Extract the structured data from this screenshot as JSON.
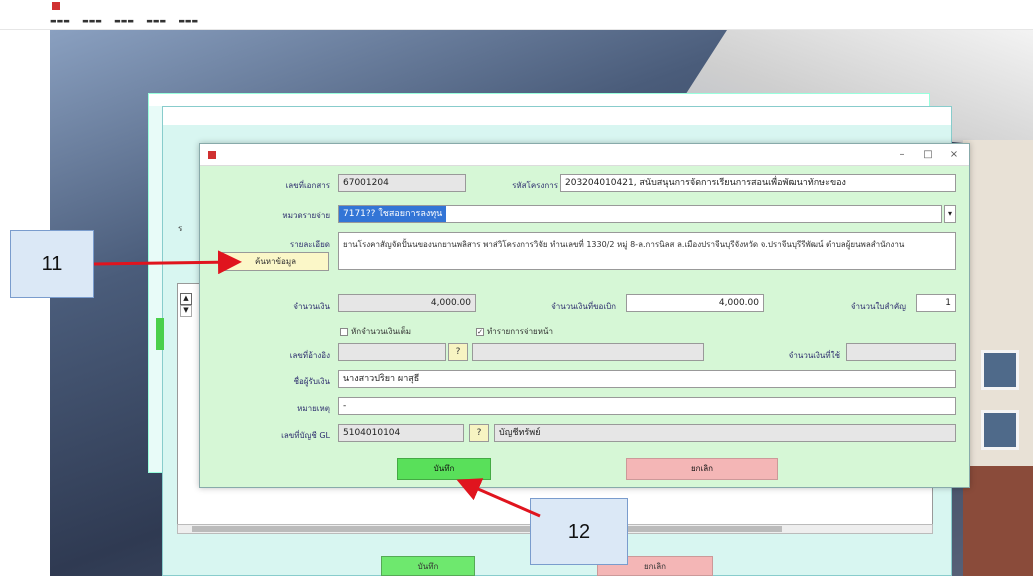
{
  "dialog": {
    "fields": {
      "document_no": {
        "value": "67001204"
      },
      "budget_code": {
        "label": "รหัสโครงการ",
        "value": "2032040104​21, สนับสนุนการจัดการเรียนการสอนเพื่อพัฒนาทักษะของ"
      },
      "expense_item": {
        "value": "7171?? ใชสอยการลงทุน"
      },
      "note_button_label": "ค้นหาข้อมูล",
      "memo": {
        "value": "ยานโรงคาสัญจัดปั้นนของนกยานพลิสาร พาส่วิโครงการวิจัย ทำนเลขที่ 1330/2 หมู่ 8-ล.การนิลส ล.เมืองปราจีนบุรีจังหวัด จ.ปราจีนบุรีรีพัฒน์ ตำบลผู้ยนพลสำนักงาน"
      },
      "amount": {
        "value": "4,000.00"
      },
      "amount_requested": {
        "value": "4,000.00"
      },
      "receipt_count": {
        "value": "1"
      },
      "checkbox_1": {
        "label": "หักจำนวนเงินเต็ม"
      },
      "checkbox_2": {
        "label": "ทำรายการจ่ายหน้า"
      },
      "payee_name": {
        "value": "นางสาวปริยา ผาสุธี"
      },
      "note": {
        "value": "-"
      },
      "gl_account": {
        "label": "เลขที่บัญชี GL",
        "value": "5104010104",
        "name_value": "บัญชีทรัพย์"
      }
    },
    "buttons": {
      "save": "บันทึก",
      "cancel": "ยกเลิก"
    }
  },
  "callouts": {
    "c11": "11",
    "c12": "12"
  },
  "background_buttons": {
    "save": "บันทึก",
    "cancel": "ยกเลิก"
  },
  "colors": {
    "dialog_bg": "#d6f7d6",
    "save_button": "#59e05a",
    "cancel_button": "#f4b6b6",
    "selection_blue": "#3375d6",
    "arrow_red": "#e0141e",
    "callout_bg": "#dbe8f6"
  }
}
